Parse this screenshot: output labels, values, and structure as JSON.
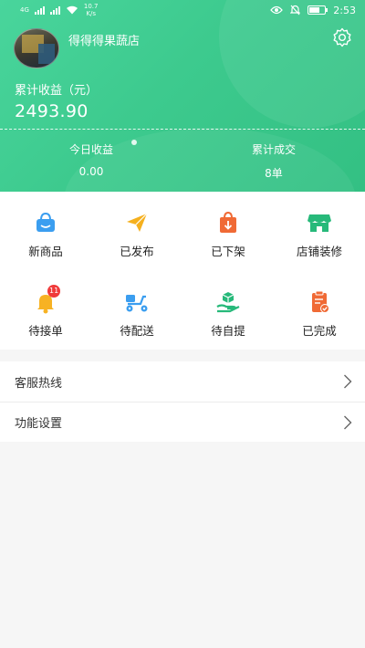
{
  "status_bar": {
    "network_text": "4G",
    "speed_value": "10.7",
    "speed_unit": "K/s",
    "time": "2:53",
    "icons": [
      "eye-icon",
      "mute-icon",
      "battery-icon"
    ]
  },
  "profile": {
    "store_name": "得得得果蔬店"
  },
  "earnings": {
    "label": "累计收益（元）",
    "value": "2493.90"
  },
  "stats": [
    {
      "label": "今日收益",
      "value": "0.00"
    },
    {
      "label": "累计成交",
      "value": "8单"
    }
  ],
  "grid": {
    "row1": [
      {
        "label": "新商品",
        "icon": "shopping-basket-icon",
        "color": "#3b9ef0"
      },
      {
        "label": "已发布",
        "icon": "paper-plane-icon",
        "color": "#f5b01e"
      },
      {
        "label": "已下架",
        "icon": "shopping-bag-icon",
        "color": "#f06a35"
      },
      {
        "label": "店铺装修",
        "icon": "storefront-icon",
        "color": "#27b97a"
      }
    ],
    "row2": [
      {
        "label": "待接单",
        "icon": "bell-icon",
        "color": "#f7b223",
        "badge": "11"
      },
      {
        "label": "待配送",
        "icon": "scooter-icon",
        "color": "#3b9ef0"
      },
      {
        "label": "待自提",
        "icon": "hand-package-icon",
        "color": "#27b97a"
      },
      {
        "label": "已完成",
        "icon": "clipboard-check-icon",
        "color": "#f06a35"
      }
    ]
  },
  "menu": [
    {
      "label": "客服热线"
    },
    {
      "label": "功能设置"
    }
  ],
  "colors": {
    "header_green": "#3dca8e",
    "badge_red": "#f03a3a"
  }
}
